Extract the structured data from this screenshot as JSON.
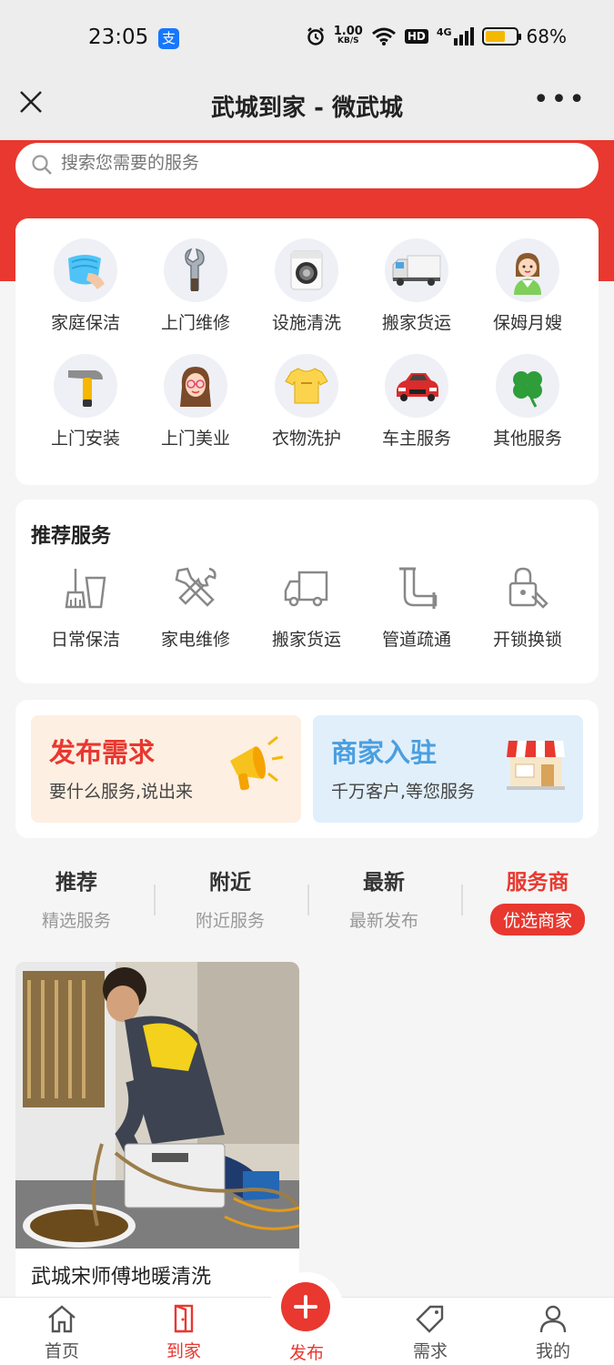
{
  "status_bar": {
    "time": "23:05",
    "network_speed": "1.00",
    "network_unit": "KB/S",
    "hd": "HD",
    "signal": "4G",
    "battery_percent": "68%",
    "battery_level": 0.68
  },
  "titlebar": {
    "title": "武城到家 - 微武城",
    "more": "•••"
  },
  "search": {
    "placeholder": "搜索您需要的服务"
  },
  "categories": [
    {
      "label": "家庭保洁",
      "icon": "cleaning-cloth-icon"
    },
    {
      "label": "上门维修",
      "icon": "wrench-icon"
    },
    {
      "label": "设施清洗",
      "icon": "washing-machine-icon"
    },
    {
      "label": "搬家货运",
      "icon": "truck-icon"
    },
    {
      "label": "保姆月嫂",
      "icon": "nanny-icon"
    },
    {
      "label": "上门安装",
      "icon": "hammer-icon"
    },
    {
      "label": "上门美业",
      "icon": "beauty-icon"
    },
    {
      "label": "衣物洗护",
      "icon": "tshirt-icon"
    },
    {
      "label": "车主服务",
      "icon": "car-icon"
    },
    {
      "label": "其他服务",
      "icon": "clover-icon"
    }
  ],
  "recommend": {
    "title": "推荐服务",
    "items": [
      {
        "label": "日常保洁",
        "icon": "broom-bucket-icon"
      },
      {
        "label": "家电维修",
        "icon": "tools-icon"
      },
      {
        "label": "搬家货运",
        "icon": "truck-outline-icon"
      },
      {
        "label": "管道疏通",
        "icon": "pipe-icon"
      },
      {
        "label": "开锁换锁",
        "icon": "lock-icon"
      }
    ]
  },
  "promo": {
    "publish": {
      "title": "发布需求",
      "subtitle": "要什么服务,说出来"
    },
    "merchant": {
      "title": "商家入驻",
      "subtitle": "千万客户,等您服务"
    }
  },
  "tabs": [
    {
      "title": "推荐",
      "sub": "精选服务"
    },
    {
      "title": "附近",
      "sub": "附近服务"
    },
    {
      "title": "最新",
      "sub": "最新发布"
    },
    {
      "title": "服务商",
      "sub": "优选商家",
      "active": true
    }
  ],
  "listing": {
    "caption": "武城宋师傅地暖清洗"
  },
  "bottom_nav": [
    {
      "label": "首页",
      "icon": "home-icon"
    },
    {
      "label": "到家",
      "icon": "door-icon",
      "active": true
    },
    {
      "label": "发布",
      "icon": "plus-icon"
    },
    {
      "label": "需求",
      "icon": "tag-icon"
    },
    {
      "label": "我的",
      "icon": "user-icon"
    }
  ],
  "colors": {
    "accent": "#e8382f",
    "merchant_blue": "#4a9fe0",
    "battery": "#f5b800"
  }
}
